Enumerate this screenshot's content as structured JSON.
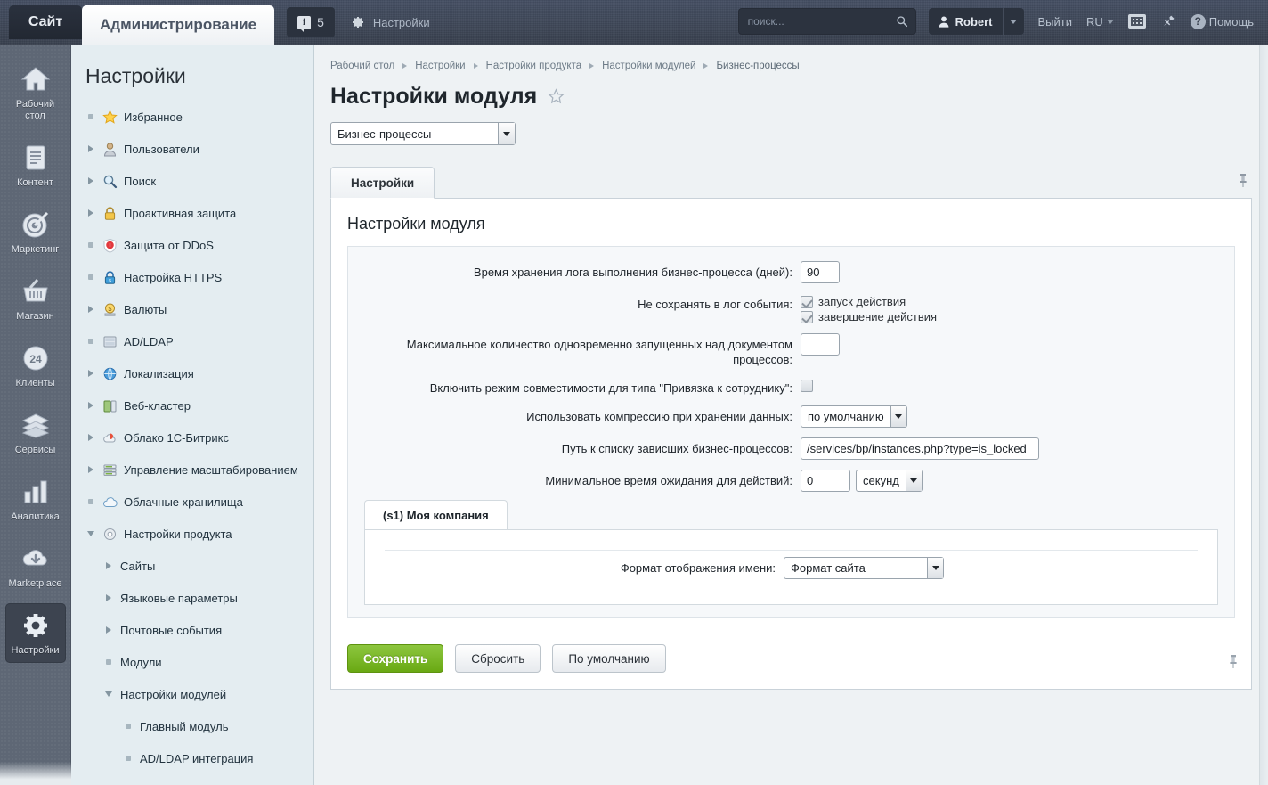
{
  "header": {
    "tab_site": "Сайт",
    "tab_admin": "Администрирование",
    "counter_icon": "info-icon",
    "counter_value": "5",
    "settings_label": "Настройки",
    "settings_icon": "gear-icon",
    "search_placeholder": "поиск...",
    "search_value": "",
    "search_icon": "search-icon",
    "user_icon": "user-icon",
    "user_name": "Robert",
    "user_dropdown_icon": "chevron-down-icon",
    "logout_label": "Выйти",
    "lang_label": "RU",
    "lang_caret_icon": "chevron-down-icon",
    "keyboard_icon": "keyboard-icon",
    "pin_icon": "pin-icon",
    "help_icon": "question-icon",
    "help_label": "Помощь"
  },
  "rail": {
    "items": [
      {
        "label": "Рабочий стол",
        "icon": "home-icon",
        "active": false
      },
      {
        "label": "Контент",
        "icon": "document-icon",
        "active": false
      },
      {
        "label": "Маркетинг",
        "icon": "target-icon",
        "active": false
      },
      {
        "label": "Магазин",
        "icon": "basket-icon",
        "active": false
      },
      {
        "label": "Клиенты",
        "icon": "circle-24-icon",
        "active": false
      },
      {
        "label": "Сервисы",
        "icon": "layers-icon",
        "active": false
      },
      {
        "label": "Аналитика",
        "icon": "bar-chart-icon",
        "active": false
      },
      {
        "label": "Marketplace",
        "icon": "cloud-download-icon",
        "active": false
      },
      {
        "label": "Настройки",
        "icon": "gear-icon",
        "active": true
      }
    ]
  },
  "tree": {
    "title": "Настройки",
    "items": [
      {
        "label": "Избранное",
        "marker": "dot",
        "icon": "star-icon",
        "level": 1
      },
      {
        "label": "Пользователи",
        "marker": "tri",
        "icon": "user-icon",
        "level": 1
      },
      {
        "label": "Поиск",
        "marker": "tri",
        "icon": "magnifier-icon",
        "level": 1
      },
      {
        "label": "Проактивная защита",
        "marker": "tri",
        "icon": "lock-icon",
        "level": 1
      },
      {
        "label": "Защита от DDoS",
        "marker": "dot",
        "icon": "shield-icon",
        "level": 1
      },
      {
        "label": "Настройка HTTPS",
        "marker": "dot",
        "icon": "https-lock-icon",
        "level": 1
      },
      {
        "label": "Валюты",
        "marker": "tri",
        "icon": "currency-icon",
        "level": 1
      },
      {
        "label": "AD/LDAP",
        "marker": "dot",
        "icon": "ldap-icon",
        "level": 1
      },
      {
        "label": "Локализация",
        "marker": "tri",
        "icon": "globe-icon",
        "level": 1
      },
      {
        "label": "Веб-кластер",
        "marker": "tri",
        "icon": "cluster-icon",
        "level": 1
      },
      {
        "label": "Облако 1С-Битрикс",
        "marker": "tri",
        "icon": "cloud-bitrix-icon",
        "level": 1
      },
      {
        "label": "Управление масштабированием",
        "marker": "tri",
        "icon": "scaling-icon",
        "level": 1
      },
      {
        "label": "Облачные хранилища",
        "marker": "dot",
        "icon": "cloud-storage-icon",
        "level": 1
      },
      {
        "label": "Настройки продукта",
        "marker": "tri-open",
        "icon": "gear-icon",
        "level": 1
      },
      {
        "label": "Сайты",
        "marker": "tri",
        "icon": "",
        "level": 2
      },
      {
        "label": "Языковые параметры",
        "marker": "tri",
        "icon": "",
        "level": 2
      },
      {
        "label": "Почтовые события",
        "marker": "tri",
        "icon": "",
        "level": 2
      },
      {
        "label": "Модули",
        "marker": "dot",
        "icon": "",
        "level": 2
      },
      {
        "label": "Настройки модулей",
        "marker": "tri-open",
        "icon": "",
        "level": 2
      },
      {
        "label": "Главный модуль",
        "marker": "dot",
        "icon": "",
        "level": 3
      },
      {
        "label": "AD/LDAP интеграция",
        "marker": "dot",
        "icon": "",
        "level": 3
      }
    ]
  },
  "main": {
    "breadcrumbs": [
      "Рабочий стол",
      "Настройки",
      "Настройки продукта",
      "Настройки модулей",
      "Бизнес-процессы"
    ],
    "page_title": "Настройки модуля",
    "favorite_icon": "star-outline-icon",
    "module_select_value": "Бизнес-процессы",
    "tab_label": "Настройки",
    "tab_pin_icon": "pin-icon",
    "panel_heading": "Настройки модуля",
    "fields": {
      "log_retention_label": "Время хранения лога выполнения бизнес-процесса (дней):",
      "log_retention_value": "90",
      "no_log_label": "Не сохранять в лог события:",
      "no_log_opt1": "запуск действия",
      "no_log_opt2": "завершение действия",
      "max_parallel_label": "Максимальное количество одновременно запущенных над документом процессов:",
      "max_parallel_value": "",
      "compat_label": "Включить режим совместимости для типа \"Привязка к сотруднику\":",
      "compression_label": "Использовать компрессию при хранении данных:",
      "compression_value": "по умолчанию",
      "hung_path_label": "Путь к списку зависших бизнес-процессов:",
      "hung_path_value": "/services/bp/instances.php?type=is_locked",
      "min_wait_label": "Минимальное время ожидания для действий:",
      "min_wait_value": "0",
      "min_wait_unit": "секунд"
    },
    "site_tab_label": "(s1) Моя компания",
    "name_format_label": "Формат отображения имени:",
    "name_format_value": "Формат сайта",
    "buttons": {
      "save": "Сохранить",
      "reset": "Сбросить",
      "default": "По умолчанию"
    },
    "panel_pin_icon": "pin-icon"
  },
  "colors": {
    "header_bg": "#3b4456",
    "rail_bg": "#5e6775",
    "tree_bg": "#e4edf1",
    "content_bg": "#eef2f4",
    "save_green": "#77b21c",
    "accent_text": "#2c3136"
  }
}
